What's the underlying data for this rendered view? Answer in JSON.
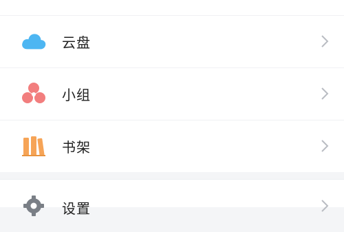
{
  "menu": {
    "items": [
      {
        "label": "云盘",
        "icon": "cloud-icon",
        "color": "#4db6f2"
      },
      {
        "label": "小组",
        "icon": "group-icon",
        "color": "#f27e7e"
      },
      {
        "label": "书架",
        "icon": "bookshelf-icon",
        "color": "#f6a457"
      }
    ],
    "settings": {
      "label": "设置",
      "icon": "gear-icon",
      "color": "#7a7f86"
    }
  }
}
